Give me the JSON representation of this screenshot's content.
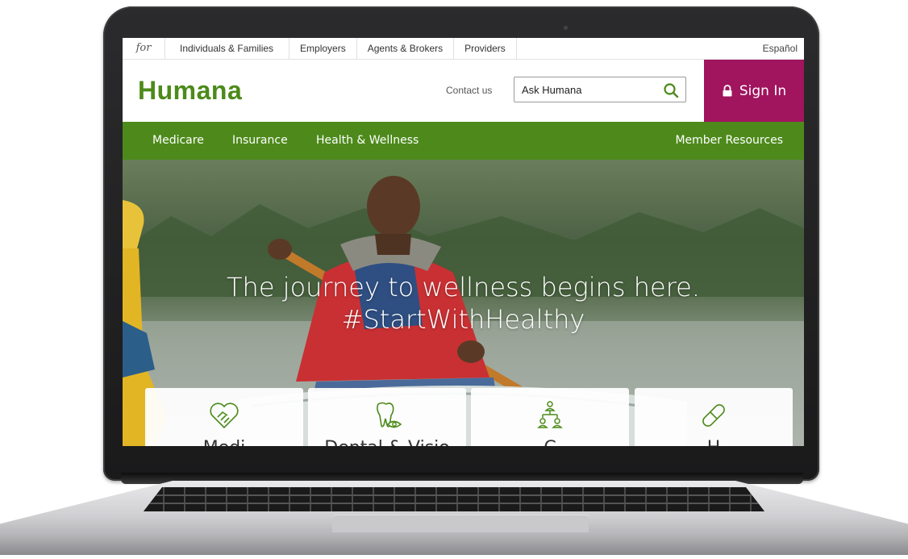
{
  "audience_bar": {
    "for_label": "for",
    "links": [
      "Individuals & Families",
      "Employers",
      "Agents & Brokers",
      "Providers"
    ],
    "language_link": "Español"
  },
  "header": {
    "logo": "Humana",
    "contact_label": "Contact us",
    "search": {
      "value": "Ask Humana",
      "icon": "search-icon"
    },
    "signin_label": "Sign In",
    "brand_green": "#4c8a1a",
    "signin_color": "#a1145e"
  },
  "nav": {
    "items": [
      "Medicare",
      "Insurance",
      "Health & Wellness"
    ],
    "right_item": "Member Resources",
    "color": "#4d8a1b"
  },
  "hero": {
    "line1": "The journey to wellness begins here.",
    "line2": "#StartWithHealthy",
    "tiles": [
      {
        "icon": "handshake-heart-icon",
        "label": "Medi"
      },
      {
        "icon": "tooth-eye-icon",
        "label": "Dental & Visio"
      },
      {
        "icon": "org-chart-icon",
        "label": "C"
      },
      {
        "icon": "pill-icon",
        "label": "H"
      }
    ]
  }
}
